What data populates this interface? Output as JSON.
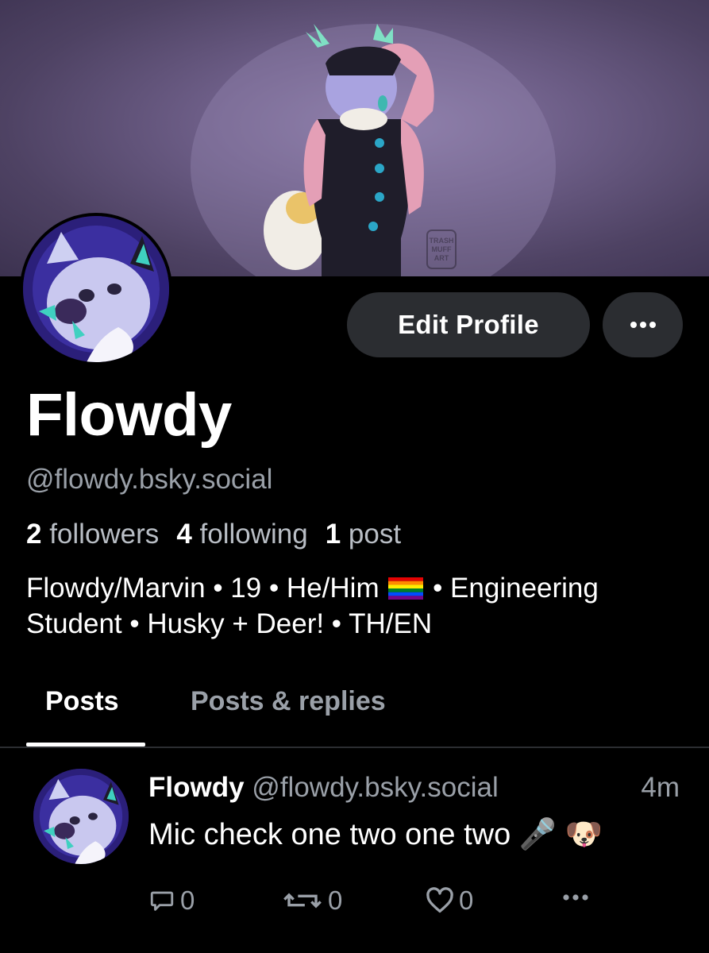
{
  "profile": {
    "display_name": "Flowdy",
    "handle": "@flowdy.bsky.social",
    "edit_label": "Edit Profile",
    "more_label": "•••",
    "stats": {
      "followers_count": "2",
      "followers_label": "followers",
      "following_count": "4",
      "following_label": "following",
      "posts_count": "1",
      "posts_label": "post"
    },
    "bio_part1": "Flowdy/Marvin • 19 • He/Him",
    "bio_part2": "• Engineering Student • Husky + Deer! • TH/EN",
    "banner_watermark": "TRASH MUFF ART"
  },
  "tabs": [
    {
      "label": "Posts",
      "active": true
    },
    {
      "label": "Posts & replies",
      "active": false
    }
  ],
  "post": {
    "author_name": "Flowdy",
    "author_handle": "@flowdy.bsky.social",
    "time": "4m",
    "text": "Mic check one two one two 🎤 🐶",
    "reply_count": "0",
    "repost_count": "0",
    "like_count": "0",
    "more_label": "•••"
  },
  "icons": {
    "reply": "comment-bubble-icon",
    "repost": "repost-arrows-icon",
    "like": "heart-icon",
    "more": "ellipsis-icon",
    "flag": "rainbow-flag-icon"
  },
  "colors": {
    "background": "#000000",
    "button_bg": "#2b2d31",
    "muted_text": "#9aa0a8",
    "banner_base": "#6c5d86"
  }
}
